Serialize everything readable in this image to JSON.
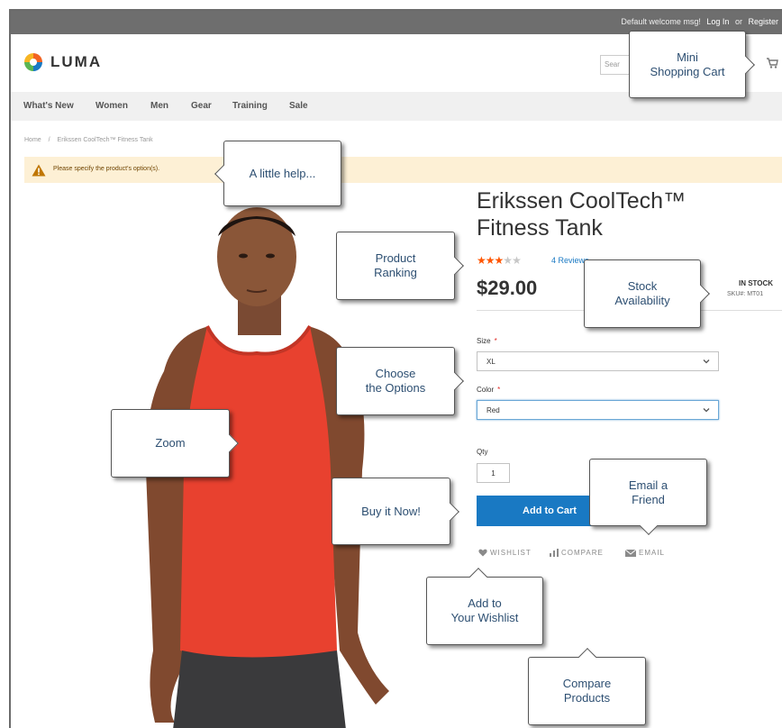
{
  "topbar": {
    "welcome": "Default welcome msg!",
    "login": "Log In",
    "or": "or",
    "register": "Register"
  },
  "header": {
    "logo_text": "LUMA",
    "search_placeholder": "Sear"
  },
  "nav": {
    "items": [
      "What's New",
      "Women",
      "Men",
      "Gear",
      "Training",
      "Sale"
    ]
  },
  "breadcrumb": {
    "home": "Home",
    "current": "Erikssen CoolTech™ Fitness Tank"
  },
  "notice": {
    "message": "Please specify the product's option(s)."
  },
  "product": {
    "title": "Erikssen CoolTech™ Fitness Tank",
    "rating_stars": 3,
    "rating_max": 5,
    "reviews": "4 Reviews",
    "price": "$29.00",
    "stock": "IN STOCK",
    "sku_label": "SKU#:",
    "sku": "MT01",
    "size_label": "Size",
    "size_value": "XL",
    "color_label": "Color",
    "color_value": "Red",
    "qty_label": "Qty",
    "qty_value": "1",
    "add_to_cart": "Add to Cart",
    "wishlist": "WISHLIST",
    "compare": "COMPARE",
    "email": "EMAIL"
  },
  "callouts": {
    "mini_cart": "Mini\nShopping Cart",
    "help": "A little help...",
    "ranking": "Product\nRanking",
    "stock": "Stock\nAvailability",
    "options": "Choose\nthe Options",
    "zoom": "Zoom",
    "buy": "Buy it Now!",
    "email": "Email a\nFriend",
    "wishlist": "Add to\nYour Wishlist",
    "compare": "Compare\nProducts"
  },
  "colors": {
    "accent": "#1979c3",
    "star": "#ff5501",
    "shirt": "#e8412f",
    "callout_text": "#2d4f72",
    "notice_bg": "#fdf0d5"
  }
}
